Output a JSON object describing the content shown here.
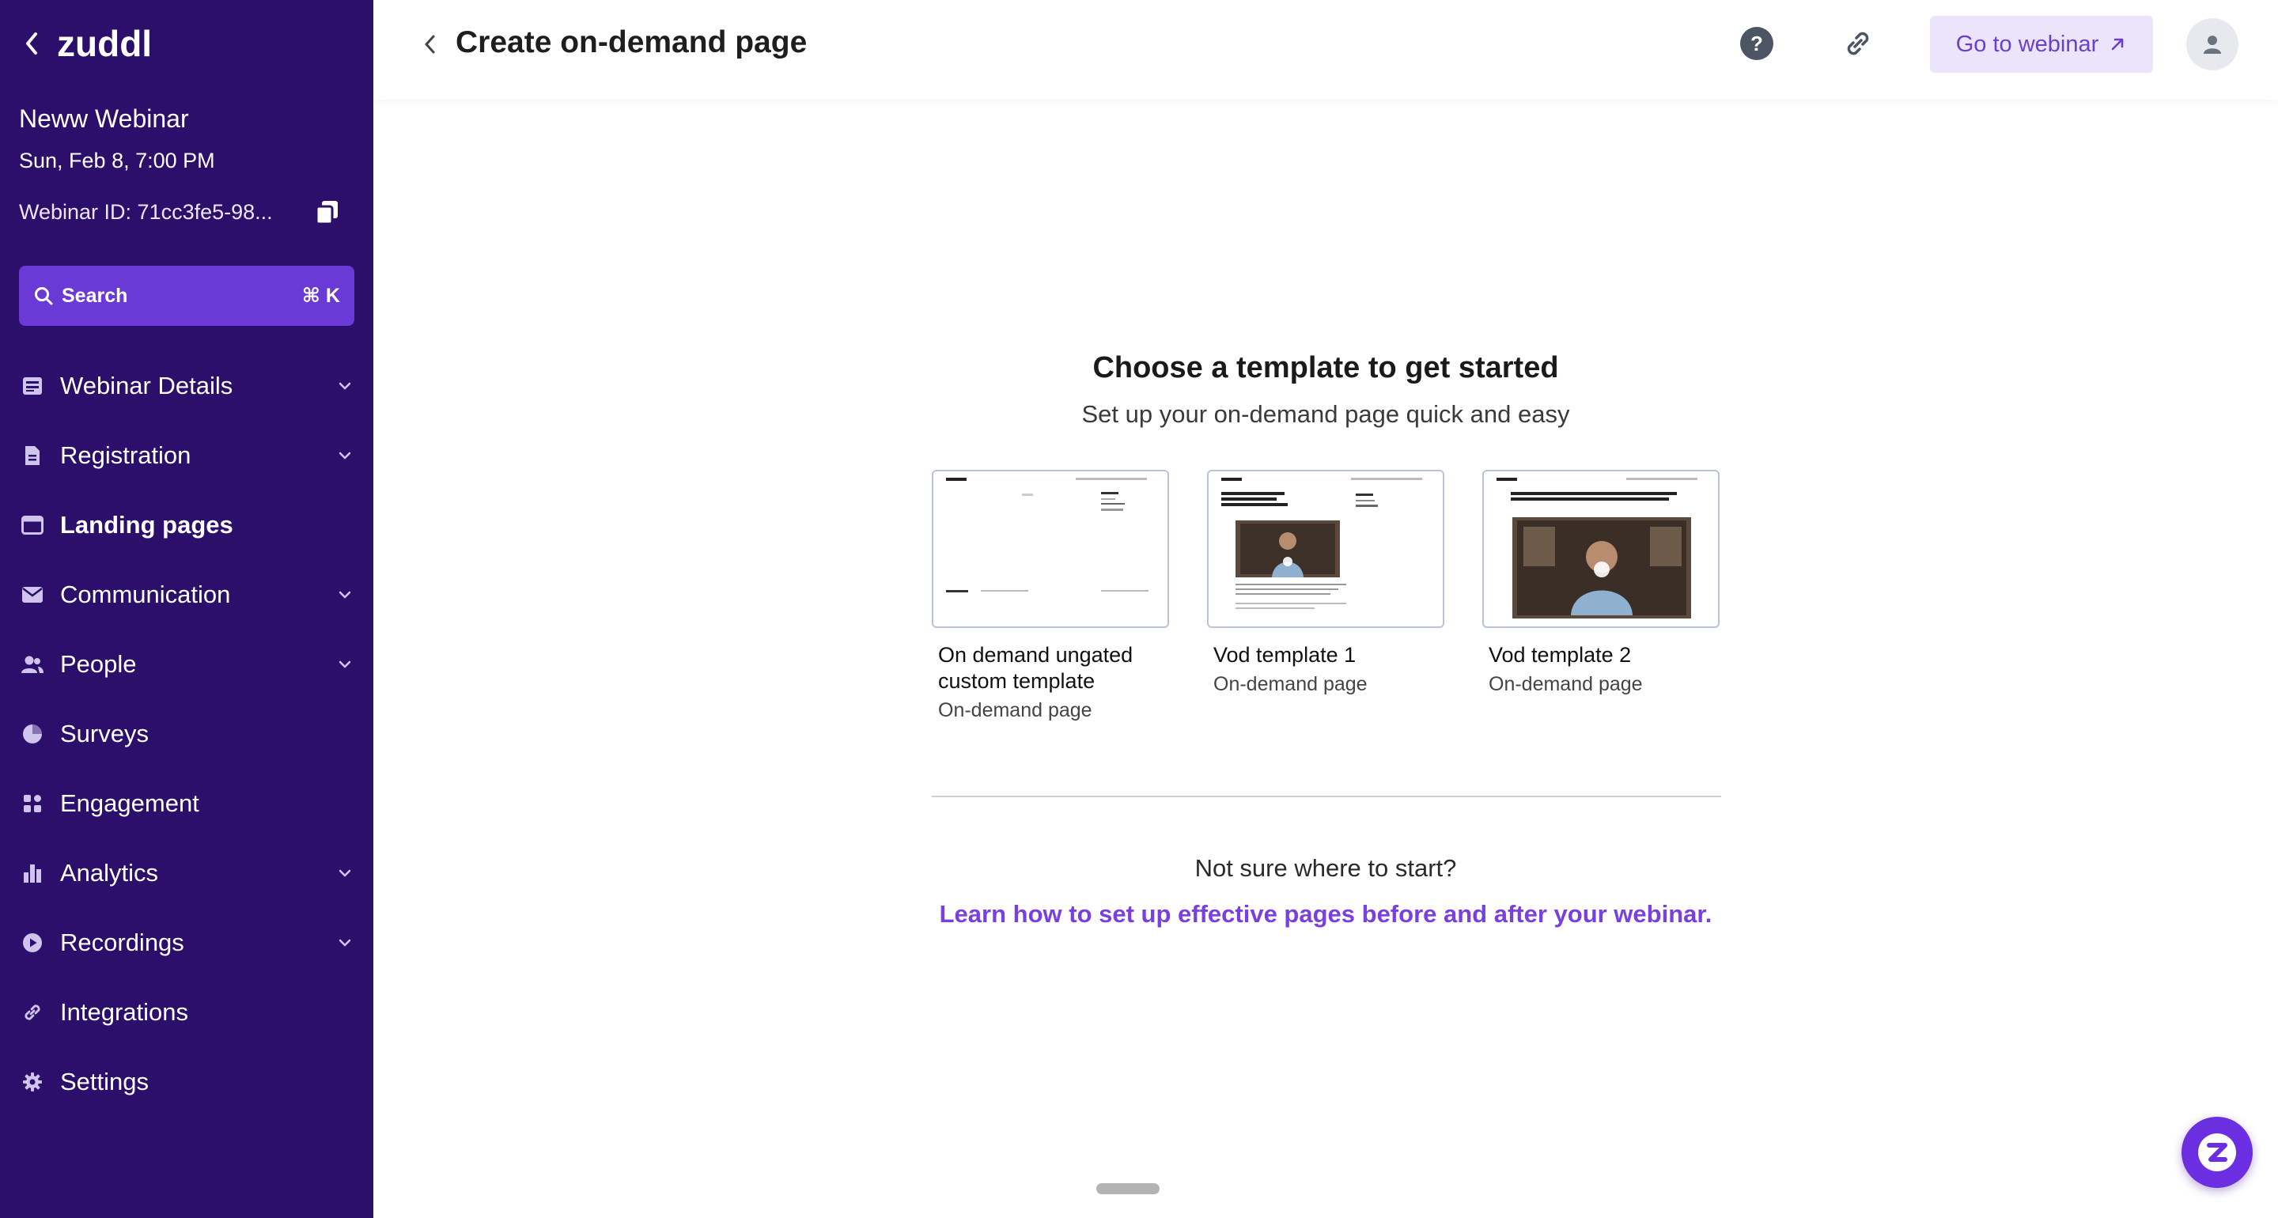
{
  "sidebar": {
    "brand": "zuddl",
    "webinar_name": "Neww Webinar",
    "webinar_date": "Sun, Feb 8, 7:00 PM",
    "webinar_id": "Webinar ID: 71cc3fe5-98...",
    "search": {
      "label": "Search",
      "shortcut": "⌘ K"
    },
    "nav": [
      {
        "label": "Webinar Details",
        "icon": "details-icon",
        "expandable": true
      },
      {
        "label": "Registration",
        "icon": "document-icon",
        "expandable": true
      },
      {
        "label": "Landing pages",
        "icon": "browser-icon",
        "expandable": false,
        "active": true
      },
      {
        "label": "Communication",
        "icon": "mail-icon",
        "expandable": true
      },
      {
        "label": "People",
        "icon": "people-icon",
        "expandable": true
      },
      {
        "label": "Surveys",
        "icon": "pie-icon",
        "expandable": false
      },
      {
        "label": "Engagement",
        "icon": "grid-icon",
        "expandable": false
      },
      {
        "label": "Analytics",
        "icon": "bar-chart-icon",
        "expandable": true
      },
      {
        "label": "Recordings",
        "icon": "play-icon",
        "expandable": true
      },
      {
        "label": "Integrations",
        "icon": "link-icon",
        "expandable": false
      },
      {
        "label": "Settings",
        "icon": "gear-icon",
        "expandable": false
      }
    ]
  },
  "header": {
    "title": "Create on-demand page",
    "go_to_webinar": "Go to webinar"
  },
  "content": {
    "title": "Choose a template to get started",
    "subtitle": "Set up your on-demand page quick and easy",
    "templates": [
      {
        "name": "On demand ungated custom template",
        "type": "On-demand page"
      },
      {
        "name": "Vod template 1",
        "type": "On-demand page"
      },
      {
        "name": "Vod template 2",
        "type": "On-demand page"
      }
    ],
    "not_sure": "Not sure where to start?",
    "learn_link": "Learn how to set up effective pages before and after your webinar."
  },
  "colors": {
    "sidebar_bg": "#2b0f6b",
    "search_bg": "#6b3ad6",
    "accent": "#7a3fe0",
    "goto_bg": "#ece4fb"
  }
}
